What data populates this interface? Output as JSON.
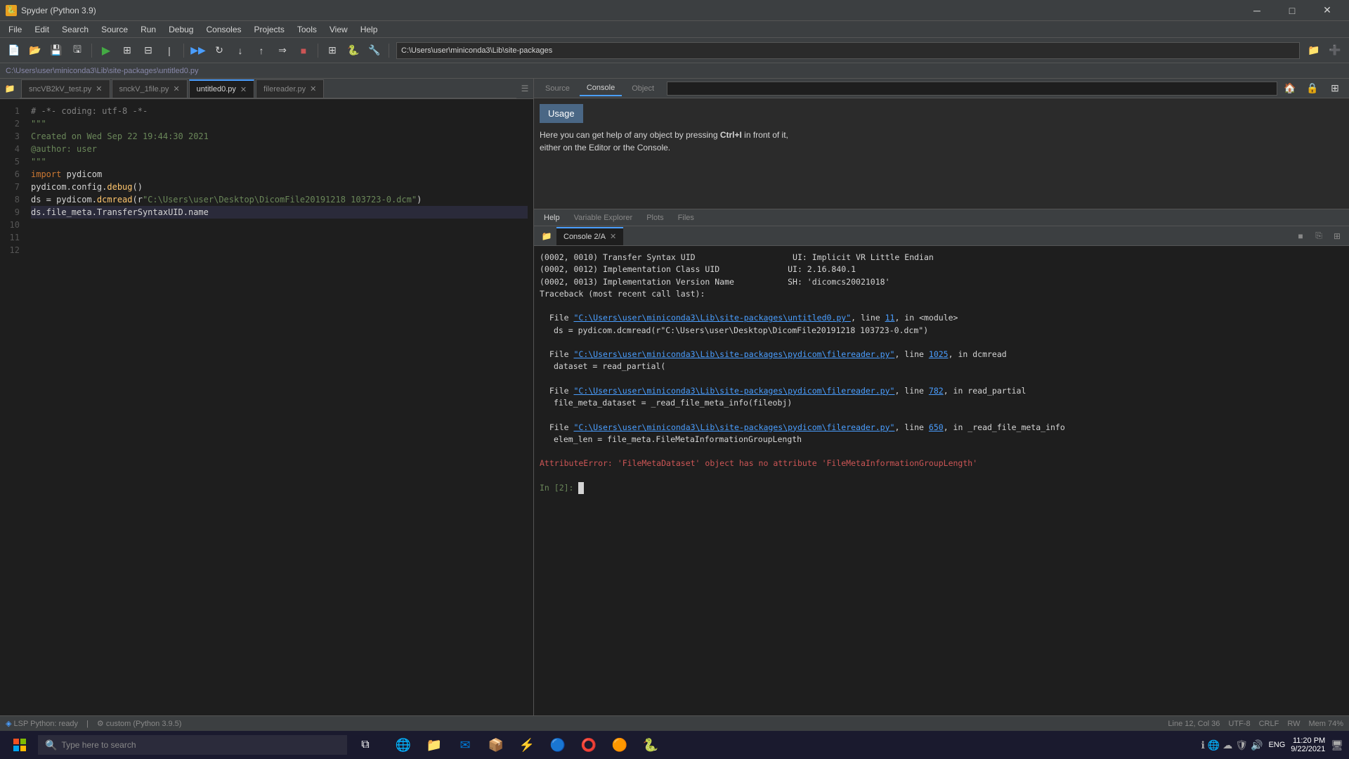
{
  "titleBar": {
    "title": "Spyder (Python 3.9)",
    "icon": "🐍",
    "minimize": "─",
    "maximize": "□",
    "close": "✕"
  },
  "menuBar": {
    "items": [
      "File",
      "Edit",
      "Search",
      "Source",
      "Run",
      "Debug",
      "Consoles",
      "Projects",
      "Tools",
      "View",
      "Help"
    ]
  },
  "toolbar": {
    "pathValue": "C:\\Users\\user\\miniconda3\\Lib\\site-packages"
  },
  "breadcrumb": {
    "text": "C:\\Users\\user\\miniconda3\\Lib\\site-packages\\untitled0.py"
  },
  "tabs": [
    {
      "label": "sncVB2kV_test.py",
      "active": false
    },
    {
      "label": "snckV_1file.py",
      "active": false
    },
    {
      "label": "untitled0.py",
      "active": true
    },
    {
      "label": "filereader.py",
      "active": false
    }
  ],
  "code": {
    "lines": [
      {
        "num": 1,
        "text": "# -*- coding: utf-8 -*-",
        "active": false
      },
      {
        "num": 2,
        "text": "\"\"\"",
        "active": false
      },
      {
        "num": 3,
        "text": "Created on Wed Sep 22 19:44:30 2021",
        "active": false
      },
      {
        "num": 4,
        "text": "",
        "active": false
      },
      {
        "num": 5,
        "text": "@author: user",
        "active": false
      },
      {
        "num": 6,
        "text": "\"\"\"",
        "active": false
      },
      {
        "num": 7,
        "text": "",
        "active": false
      },
      {
        "num": 8,
        "text": "import pydicom",
        "active": false
      },
      {
        "num": 9,
        "text": "",
        "active": false
      },
      {
        "num": 10,
        "text": "pydicom.config.debug()",
        "active": false
      },
      {
        "num": 11,
        "text": "ds = pydicom.dcmread(r\"C:\\Users\\user\\Desktop\\DicomFile20191218 103723-0.dcm\")",
        "active": false
      },
      {
        "num": 12,
        "text": "ds.file_meta.TransferSyntaxUID.name",
        "active": true
      }
    ]
  },
  "helpPanel": {
    "tabs": [
      "Source",
      "Console",
      "Object"
    ],
    "activeTab": "Console",
    "usageLabel": "Usage",
    "helpText": "Here you can get help of any object by pressing Ctrl+I in front of it,\neither on the Editor or the Console.",
    "bottomTabs": [
      "Help",
      "Variable Explorer",
      "Plots",
      "Files"
    ]
  },
  "console": {
    "tabLabel": "Console 2/A",
    "output": [
      "(0002, 0010) Transfer Syntax UID                    UI: Implicit VR Little Endian",
      "(0002, 0012) Implementation Class UID              UI: 2.16.840.1",
      "(0002, 0013) Implementation Version Name          SH: 'dicomcs20021018'",
      "Traceback (most recent call last):",
      "",
      "  File \"C:\\Users\\user\\miniconda3\\Lib\\site-packages\\untitled0.py\", line 11, in <module>",
      "    ds = pydicom.dcmread(r\"C:\\Users\\user\\Desktop\\DicomFile20191218 103723-0.dcm\")",
      "",
      "  File \"C:\\Users\\user\\miniconda3\\Lib\\site-packages\\pydicom\\filereader.py\", line 1025, in dcmread",
      "    dataset = read_partial(",
      "",
      "  File \"C:\\Users\\user\\miniconda3\\Lib\\site-packages\\pydicom\\filereader.py\", line 782, in read_partial",
      "    file_meta_dataset = _read_file_meta_info(fileobj)",
      "",
      "  File \"C:\\Users\\user\\miniconda3\\Lib\\site-packages\\pydicom\\filereader.py\", line 650, in _read_file_meta_info",
      "    elem_len = file_meta.FileMetaInformationGroupLength",
      "",
      "AttributeError: 'FileMetaDataset' object has no attribute 'FileMetaInformationGroupLength'",
      "",
      "In [2]: "
    ]
  },
  "statusBar": {
    "lsp": "LSP Python: ready",
    "interpreter": "custom (Python 3.9.5)",
    "position": "Line 12, Col 36",
    "encoding": "UTF-8",
    "eol": "CRLF",
    "mode": "RW",
    "memory": "Mem 74%"
  },
  "taskbar": {
    "searchPlaceholder": "Type here to search",
    "clock": "11:20 PM\n9/22/2021",
    "language": "ENG"
  }
}
